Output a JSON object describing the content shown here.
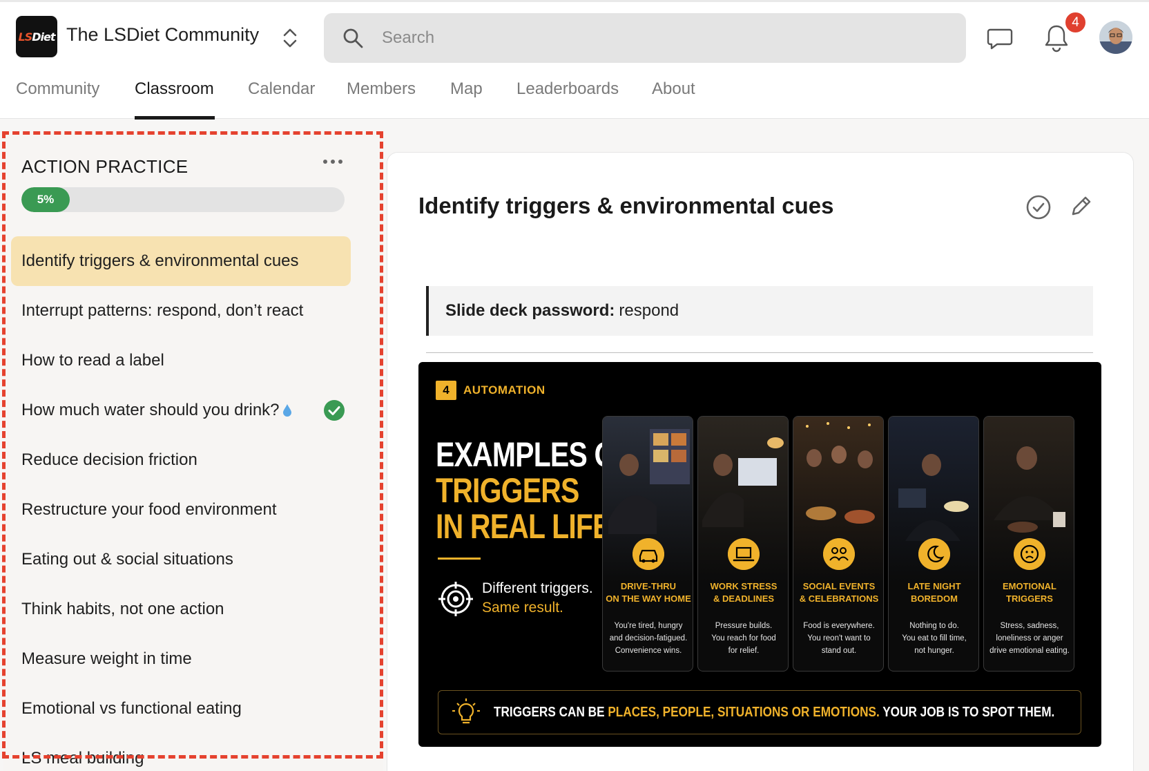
{
  "app": {
    "name": "The LSDiet Community",
    "logo_text_a": "LS",
    "logo_text_b": "Diet"
  },
  "search": {
    "placeholder": "Search"
  },
  "notifications": {
    "count": "4"
  },
  "nav": {
    "items": [
      "Community",
      "Classroom",
      "Calendar",
      "Members",
      "Map",
      "Leaderboards",
      "About"
    ],
    "active": "Classroom"
  },
  "sidebar": {
    "section_title": "ACTION PRACTICE",
    "progress_label": "5%",
    "progress_value": 0.05,
    "lessons": [
      {
        "label": "Identify triggers & environmental cues",
        "active": true
      },
      {
        "label": "Interrupt patterns: respond, don’t react"
      },
      {
        "label": "How to read a label"
      },
      {
        "label": "How much water should you drink?",
        "completed": true,
        "icon": "water-drop-icon"
      },
      {
        "label": "Reduce decision friction"
      },
      {
        "label": "Restructure your food environment"
      },
      {
        "label": "Eating out & social situations"
      },
      {
        "label": "Think habits, not one action"
      },
      {
        "label": "Measure weight in time"
      },
      {
        "label": "Emotional vs functional eating"
      },
      {
        "label": "LS meal building"
      }
    ]
  },
  "lesson": {
    "title": "Identify triggers & environmental cues",
    "callout_label": "Slide deck password:",
    "callout_value": "respond"
  },
  "slide": {
    "tag_number": "4",
    "tag_label": "AUTOMATION",
    "headline_1": "EXAMPLES OF",
    "headline_2": "TRIGGERS",
    "headline_3": "IN REAL LIFE",
    "tagline_1": "Different triggers.",
    "tagline_2": "Same result.",
    "cards": [
      {
        "title_1": "DRIVE-THRU",
        "title_2": "ON THE WAY HOME",
        "text_1": "You're tired, hungry",
        "text_2": "and decision-fatigued.",
        "text_3": "Convenience wins.",
        "icon": "car-icon"
      },
      {
        "title_1": "WORK STRESS",
        "title_2": "& DEADLINES",
        "text_1": "Pressure builds.",
        "text_2": "You reach for food",
        "text_3": "for relief.",
        "icon": "laptop-icon"
      },
      {
        "title_1": "SOCIAL EVENTS",
        "title_2": "& CELEBRATIONS",
        "text_1": "Food is everywhere.",
        "text_2": "You reon't want to",
        "text_3": "stand out.",
        "icon": "people-icon"
      },
      {
        "title_1": "LATE NIGHT",
        "title_2": "BOREDOM",
        "text_1": "Nothing to do.",
        "text_2": "You eat to fill time,",
        "text_3": "not hunger.",
        "icon": "moon-icon"
      },
      {
        "title_1": "EMOTIONAL",
        "title_2": "TRIGGERS",
        "text_1": "Stress, sadness,",
        "text_2": "loneliness or anger",
        "text_3": "drive emotional eating.",
        "icon": "sad-face-icon"
      }
    ],
    "footer_1": "TRIGGERS CAN BE ",
    "footer_2": "PLACES, PEOPLE, SITUATIONS OR EMOTIONS.",
    "footer_3": " YOUR JOB IS TO SPOT THEM."
  },
  "colors": {
    "accent_yellow": "#f0b22b",
    "active_lesson_bg": "#f7e2b1",
    "progress_green": "#3a9a53",
    "badge_red": "#e0402f",
    "annotation_red": "#e5422f"
  }
}
